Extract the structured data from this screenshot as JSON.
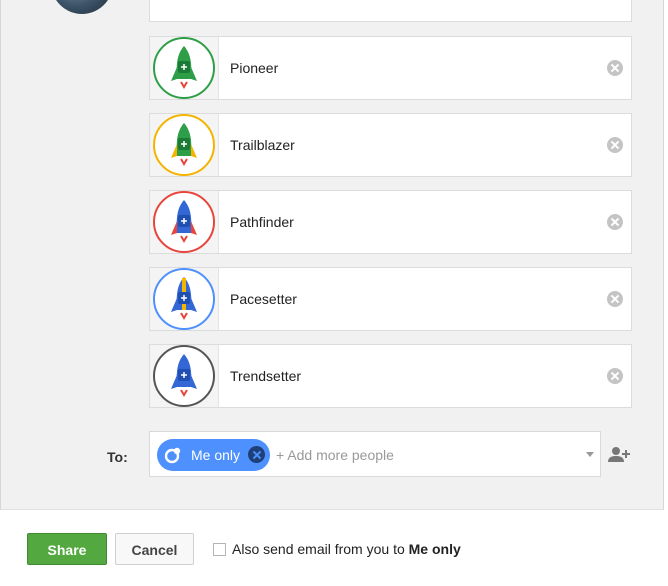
{
  "badges": [
    {
      "name": "Pioneer",
      "ring": "#2e9e48",
      "body": "#2e9e48",
      "flame": "#e8453c"
    },
    {
      "name": "Trailblazer",
      "ring": "#f4b400",
      "body": "#2e9e48",
      "fins": "#f4b400",
      "flame": "#e8453c"
    },
    {
      "name": "Pathfinder",
      "ring": "#e8453c",
      "body": "#3367d6",
      "fins": "#e8453c",
      "flame": "#e8453c"
    },
    {
      "name": "Pacesetter",
      "ring": "#4d90fe",
      "body": "#3367d6",
      "fins": "#3367d6",
      "flame": "#e8453c"
    },
    {
      "name": "Trendsetter",
      "ring": "#555555",
      "body": "#3367d6",
      "fins": "#3367d6",
      "flame": "#e8453c"
    }
  ],
  "share": {
    "to_label": "To:",
    "chip_label": "Me only",
    "add_more_placeholder": "+ Add more people"
  },
  "footer": {
    "share_label": "Share",
    "cancel_label": "Cancel",
    "email_text_prefix": "Also send email from you to",
    "email_text_target": "Me only"
  },
  "colors": {
    "share_green": "#53a93f",
    "chip_blue": "#4d90fe"
  }
}
